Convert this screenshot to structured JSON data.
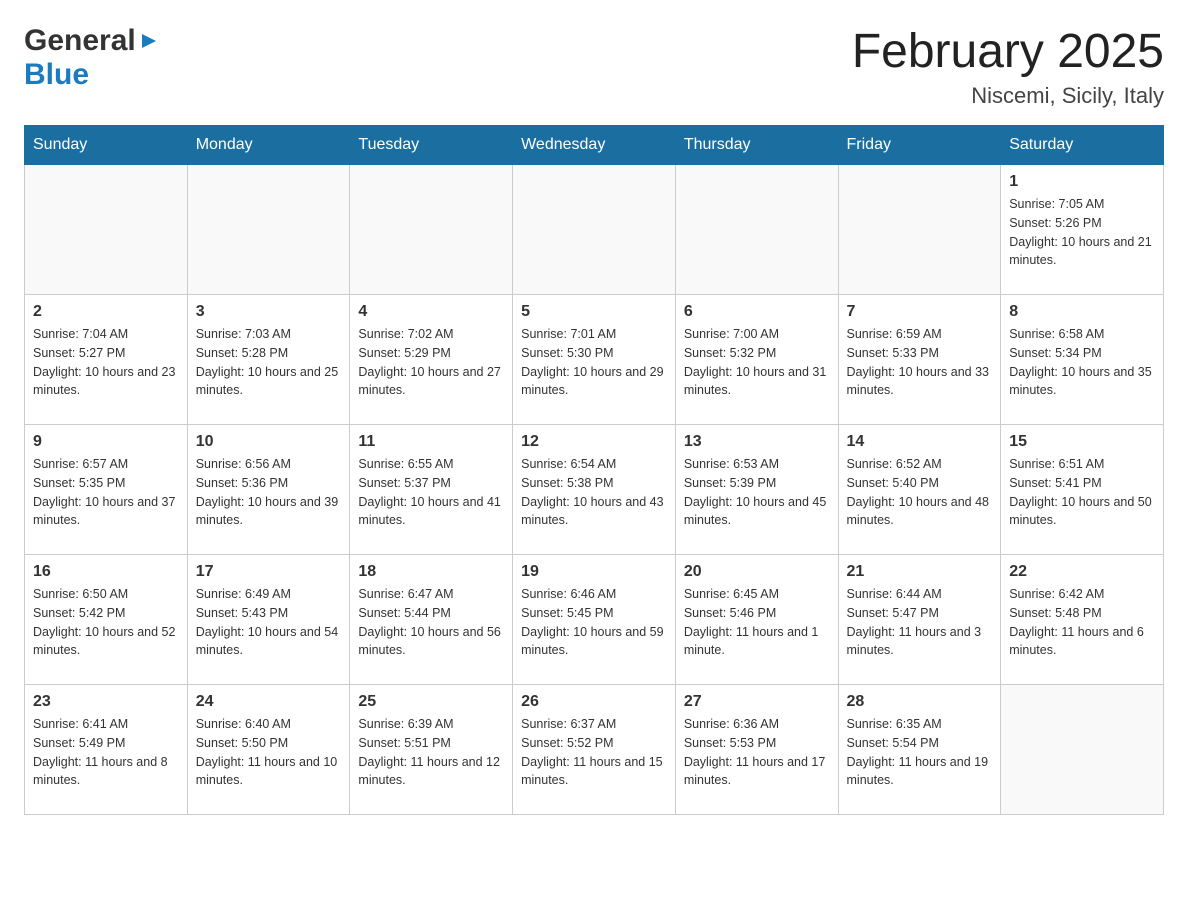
{
  "header": {
    "logo_general": "General",
    "logo_blue": "Blue",
    "month_title": "February 2025",
    "location": "Niscemi, Sicily, Italy"
  },
  "days_of_week": [
    "Sunday",
    "Monday",
    "Tuesday",
    "Wednesday",
    "Thursday",
    "Friday",
    "Saturday"
  ],
  "weeks": [
    [
      {
        "day": "",
        "info": ""
      },
      {
        "day": "",
        "info": ""
      },
      {
        "day": "",
        "info": ""
      },
      {
        "day": "",
        "info": ""
      },
      {
        "day": "",
        "info": ""
      },
      {
        "day": "",
        "info": ""
      },
      {
        "day": "1",
        "info": "Sunrise: 7:05 AM\nSunset: 5:26 PM\nDaylight: 10 hours and 21 minutes."
      }
    ],
    [
      {
        "day": "2",
        "info": "Sunrise: 7:04 AM\nSunset: 5:27 PM\nDaylight: 10 hours and 23 minutes."
      },
      {
        "day": "3",
        "info": "Sunrise: 7:03 AM\nSunset: 5:28 PM\nDaylight: 10 hours and 25 minutes."
      },
      {
        "day": "4",
        "info": "Sunrise: 7:02 AM\nSunset: 5:29 PM\nDaylight: 10 hours and 27 minutes."
      },
      {
        "day": "5",
        "info": "Sunrise: 7:01 AM\nSunset: 5:30 PM\nDaylight: 10 hours and 29 minutes."
      },
      {
        "day": "6",
        "info": "Sunrise: 7:00 AM\nSunset: 5:32 PM\nDaylight: 10 hours and 31 minutes."
      },
      {
        "day": "7",
        "info": "Sunrise: 6:59 AM\nSunset: 5:33 PM\nDaylight: 10 hours and 33 minutes."
      },
      {
        "day": "8",
        "info": "Sunrise: 6:58 AM\nSunset: 5:34 PM\nDaylight: 10 hours and 35 minutes."
      }
    ],
    [
      {
        "day": "9",
        "info": "Sunrise: 6:57 AM\nSunset: 5:35 PM\nDaylight: 10 hours and 37 minutes."
      },
      {
        "day": "10",
        "info": "Sunrise: 6:56 AM\nSunset: 5:36 PM\nDaylight: 10 hours and 39 minutes."
      },
      {
        "day": "11",
        "info": "Sunrise: 6:55 AM\nSunset: 5:37 PM\nDaylight: 10 hours and 41 minutes."
      },
      {
        "day": "12",
        "info": "Sunrise: 6:54 AM\nSunset: 5:38 PM\nDaylight: 10 hours and 43 minutes."
      },
      {
        "day": "13",
        "info": "Sunrise: 6:53 AM\nSunset: 5:39 PM\nDaylight: 10 hours and 45 minutes."
      },
      {
        "day": "14",
        "info": "Sunrise: 6:52 AM\nSunset: 5:40 PM\nDaylight: 10 hours and 48 minutes."
      },
      {
        "day": "15",
        "info": "Sunrise: 6:51 AM\nSunset: 5:41 PM\nDaylight: 10 hours and 50 minutes."
      }
    ],
    [
      {
        "day": "16",
        "info": "Sunrise: 6:50 AM\nSunset: 5:42 PM\nDaylight: 10 hours and 52 minutes."
      },
      {
        "day": "17",
        "info": "Sunrise: 6:49 AM\nSunset: 5:43 PM\nDaylight: 10 hours and 54 minutes."
      },
      {
        "day": "18",
        "info": "Sunrise: 6:47 AM\nSunset: 5:44 PM\nDaylight: 10 hours and 56 minutes."
      },
      {
        "day": "19",
        "info": "Sunrise: 6:46 AM\nSunset: 5:45 PM\nDaylight: 10 hours and 59 minutes."
      },
      {
        "day": "20",
        "info": "Sunrise: 6:45 AM\nSunset: 5:46 PM\nDaylight: 11 hours and 1 minute."
      },
      {
        "day": "21",
        "info": "Sunrise: 6:44 AM\nSunset: 5:47 PM\nDaylight: 11 hours and 3 minutes."
      },
      {
        "day": "22",
        "info": "Sunrise: 6:42 AM\nSunset: 5:48 PM\nDaylight: 11 hours and 6 minutes."
      }
    ],
    [
      {
        "day": "23",
        "info": "Sunrise: 6:41 AM\nSunset: 5:49 PM\nDaylight: 11 hours and 8 minutes."
      },
      {
        "day": "24",
        "info": "Sunrise: 6:40 AM\nSunset: 5:50 PM\nDaylight: 11 hours and 10 minutes."
      },
      {
        "day": "25",
        "info": "Sunrise: 6:39 AM\nSunset: 5:51 PM\nDaylight: 11 hours and 12 minutes."
      },
      {
        "day": "26",
        "info": "Sunrise: 6:37 AM\nSunset: 5:52 PM\nDaylight: 11 hours and 15 minutes."
      },
      {
        "day": "27",
        "info": "Sunrise: 6:36 AM\nSunset: 5:53 PM\nDaylight: 11 hours and 17 minutes."
      },
      {
        "day": "28",
        "info": "Sunrise: 6:35 AM\nSunset: 5:54 PM\nDaylight: 11 hours and 19 minutes."
      },
      {
        "day": "",
        "info": ""
      }
    ]
  ]
}
